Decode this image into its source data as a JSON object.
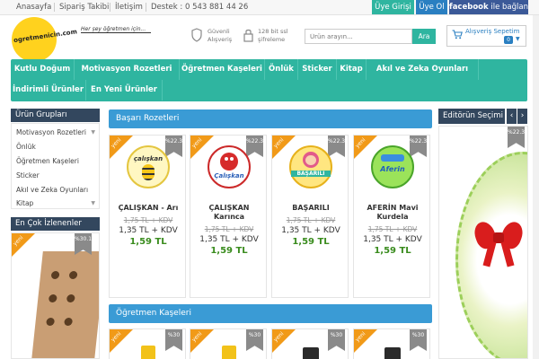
{
  "topbar": {
    "links": [
      "Anasayfa",
      "Sipariş Takibi",
      "İletişim",
      "Destek : 0 543 881 44 26"
    ],
    "login": "Üye Girişi",
    "register": "Üye Ol",
    "facebook_brand": "facebook",
    "facebook_text": "ile bağlan"
  },
  "header": {
    "logo_text": "ogretmenicin.com",
    "tagline": "Her şey öğretmen için...",
    "secure_line1": "Güvenli",
    "secure_line2": "Alışveriş",
    "ssl_line1": "128 bit ssl",
    "ssl_line2": "şifreleme",
    "search_placeholder": "Ürün arayın...",
    "search_button": "Ara",
    "cart_label": "Alışveriş Sepetim",
    "cart_count": "0"
  },
  "nav": {
    "row1": [
      "Kutlu Doğum",
      "Motivasyon Rozetleri",
      "Öğretmen Kaşeleri",
      "Önlük",
      "Sticker",
      "Kitap",
      "Akıl ve Zeka Oyunları"
    ],
    "row2": [
      "İndirimli Ürünler",
      "En Yeni Ürünler"
    ]
  },
  "sidebar": {
    "groups_title": "Ürün Grupları",
    "categories": [
      "Motivasyon Rozetleri",
      "Önlük",
      "Öğretmen Kaşeleri",
      "Sticker",
      "Akıl ve Zeka Oyunları",
      "Kitap"
    ],
    "most_viewed_title": "En Çok İzlenenler",
    "most_viewed_discount": "%30.1"
  },
  "editor": {
    "title": "Editörün Seçimi",
    "discount": "%22.3",
    "prev": "‹",
    "next": "›"
  },
  "section1": {
    "title": "Başarı Rozetleri",
    "products": [
      {
        "badge_text": "çalışkan",
        "name1": "ÇALIŞKAN - Arı",
        "name2": "",
        "old_price": "1,75 TL + KDV",
        "price": "1,35 TL + KDV",
        "final_price": "1,59 TL",
        "discount": "%22.3",
        "tag": "yeni"
      },
      {
        "badge_text": "Çalışkan",
        "name1": "ÇALIŞKAN",
        "name2": "Karınca",
        "old_price": "1,75 TL + KDV",
        "price": "1,35 TL + KDV",
        "final_price": "1,59 TL",
        "discount": "%22.3",
        "tag": "yeni"
      },
      {
        "badge_text": "BAŞARILI",
        "name1": "BAŞARILI",
        "name2": "",
        "old_price": "1,75 TL + KDV",
        "price": "1,35 TL + KDV",
        "final_price": "1,59 TL",
        "discount": "%22.3",
        "tag": "yeni"
      },
      {
        "badge_text": "Aferin",
        "name1": "AFERİN  Mavi",
        "name2": "Kurdela",
        "old_price": "1,75 TL + KDV",
        "price": "1,35 TL + KDV",
        "final_price": "1,59 TL",
        "discount": "%22.3",
        "tag": "yeni"
      }
    ]
  },
  "section2": {
    "title": "Öğretmen Kaşeleri",
    "products": [
      {
        "discount": "%30",
        "tag": "yeni"
      },
      {
        "discount": "%30",
        "tag": "yeni"
      },
      {
        "discount": "%30",
        "tag": "yeni"
      },
      {
        "discount": "%30",
        "tag": "yeni"
      }
    ]
  },
  "colors": {
    "teal": "#2fb5a0",
    "blue": "#3a9bd5",
    "navy": "#33475e",
    "orange": "#f19a18",
    "green_price": "#3a8c1e",
    "logo_yellow": "#ffd21e"
  }
}
